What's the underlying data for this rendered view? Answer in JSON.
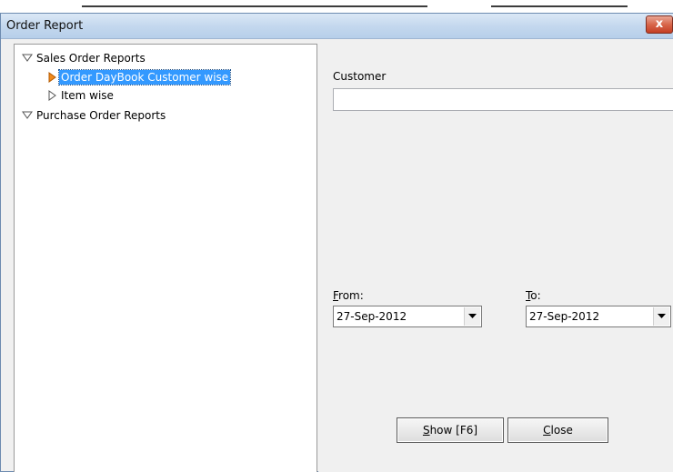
{
  "window": {
    "title": "Order Report",
    "close_label": "x"
  },
  "tree": {
    "items": [
      {
        "label": "Sales Order Reports",
        "icon": "expanded-triangle-icon"
      },
      {
        "label": "Order DayBook Customer wise",
        "icon": "play-arrow-icon",
        "selected": true
      },
      {
        "label": "Item wise",
        "icon": "collapsed-arrow-icon"
      },
      {
        "label": "Purchase Order Reports",
        "icon": "expanded-triangle-icon"
      }
    ]
  },
  "form": {
    "customer_label": "Customer",
    "customer_value": "",
    "from_label_mnemonic": "F",
    "from_label_rest": "rom:",
    "from_value": "27-Sep-2012",
    "to_label_mnemonic": "T",
    "to_label_rest": "o:",
    "to_value": "27-Sep-2012"
  },
  "buttons": {
    "show_mnemonic": "S",
    "show_rest": "how [F6]",
    "close_mnemonic": "C",
    "close_rest": "lose"
  },
  "colors": {
    "selection": "#3399ff",
    "arrow_orange": "#f08a1c",
    "titlebar": "#c4d8ee",
    "close_red": "#d8664b"
  }
}
